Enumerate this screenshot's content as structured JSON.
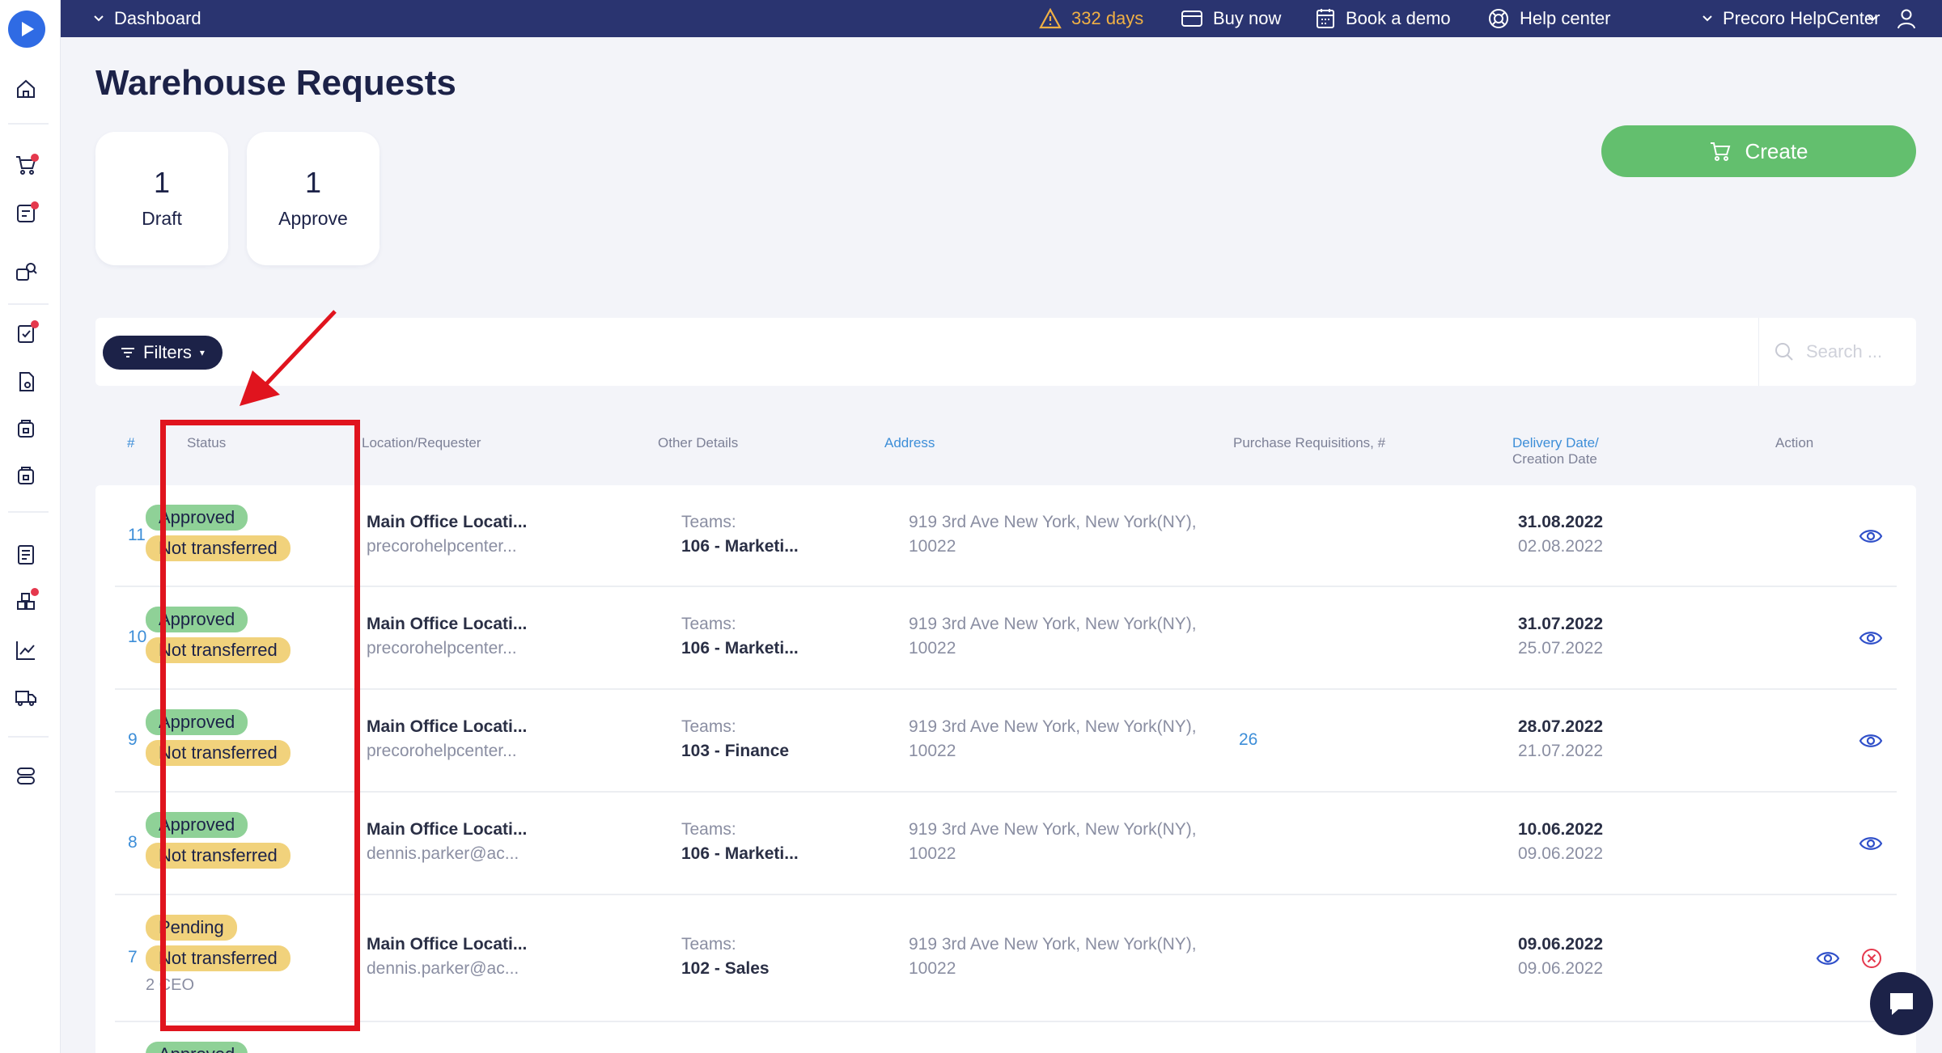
{
  "topbar": {
    "dashboard_label": "Dashboard",
    "trial_days": "332 days",
    "buy_now": "Buy now",
    "book_demo": "Book a demo",
    "help_center": "Help center",
    "company": "Precoro HelpCenter"
  },
  "page": {
    "title": "Warehouse Requests"
  },
  "stats": [
    {
      "count": "1",
      "label": "Draft"
    },
    {
      "count": "1",
      "label": "Approve"
    }
  ],
  "create_label": "Create",
  "filters_label": "Filters",
  "search_placeholder": "Search ...",
  "columns": {
    "index": "#",
    "status": "Status",
    "location": "Location/Requester",
    "other": "Other Details",
    "address": "Address",
    "pr": "Purchase Requisitions, #",
    "delivery": "Delivery Date/",
    "creation": "Creation Date",
    "action": "Action"
  },
  "rows": [
    {
      "id": "11",
      "status": "Approved",
      "transfer": "Not transferred",
      "extra": "",
      "location": "Main Office Locati...",
      "requester": "precorohelpcenter...",
      "teams_label": "Teams:",
      "team": "106 - Marketi...",
      "address1": "919 3rd Ave New York, New York(NY),",
      "address2": "10022",
      "pr": "",
      "delivery": "31.08.2022",
      "created": "02.08.2022"
    },
    {
      "id": "10",
      "status": "Approved",
      "transfer": "Not transferred",
      "extra": "",
      "location": "Main Office Locati...",
      "requester": "precorohelpcenter...",
      "teams_label": "Teams:",
      "team": "106 - Marketi...",
      "address1": "919 3rd Ave New York, New York(NY),",
      "address2": "10022",
      "pr": "",
      "delivery": "31.07.2022",
      "created": "25.07.2022"
    },
    {
      "id": "9",
      "status": "Approved",
      "transfer": "Not transferred",
      "extra": "",
      "location": "Main Office Locati...",
      "requester": "precorohelpcenter...",
      "teams_label": "Teams:",
      "team": "103 - Finance",
      "address1": "919 3rd Ave New York, New York(NY),",
      "address2": "10022",
      "pr": "26",
      "delivery": "28.07.2022",
      "created": "21.07.2022"
    },
    {
      "id": "8",
      "status": "Approved",
      "transfer": "Not transferred",
      "extra": "",
      "location": "Main Office Locati...",
      "requester": "dennis.parker@ac...",
      "teams_label": "Teams:",
      "team": "106 - Marketi...",
      "address1": "919 3rd Ave New York, New York(NY),",
      "address2": "10022",
      "pr": "",
      "delivery": "10.06.2022",
      "created": "09.06.2022"
    },
    {
      "id": "7",
      "status": "Pending",
      "transfer": "Not transferred",
      "extra": "2 CEO",
      "location": "Main Office Locati...",
      "requester": "dennis.parker@ac...",
      "teams_label": "Teams:",
      "team": "102 - Sales",
      "address1": "919 3rd Ave New York, New York(NY),",
      "address2": "10022",
      "pr": "",
      "delivery": "09.06.2022",
      "created": "09.06.2022"
    },
    {
      "id": "",
      "status": "Approved",
      "transfer": "",
      "extra": "",
      "location": "",
      "requester": "",
      "teams_label": "",
      "team": "",
      "address1": "",
      "address2": "",
      "pr": "",
      "delivery": "",
      "created": ""
    }
  ],
  "colors": {
    "topbar": "#2a3470",
    "create": "#63bf6e",
    "approved": "#8fd197",
    "pending": "#f1d27c",
    "annotation": "#e0141e"
  }
}
